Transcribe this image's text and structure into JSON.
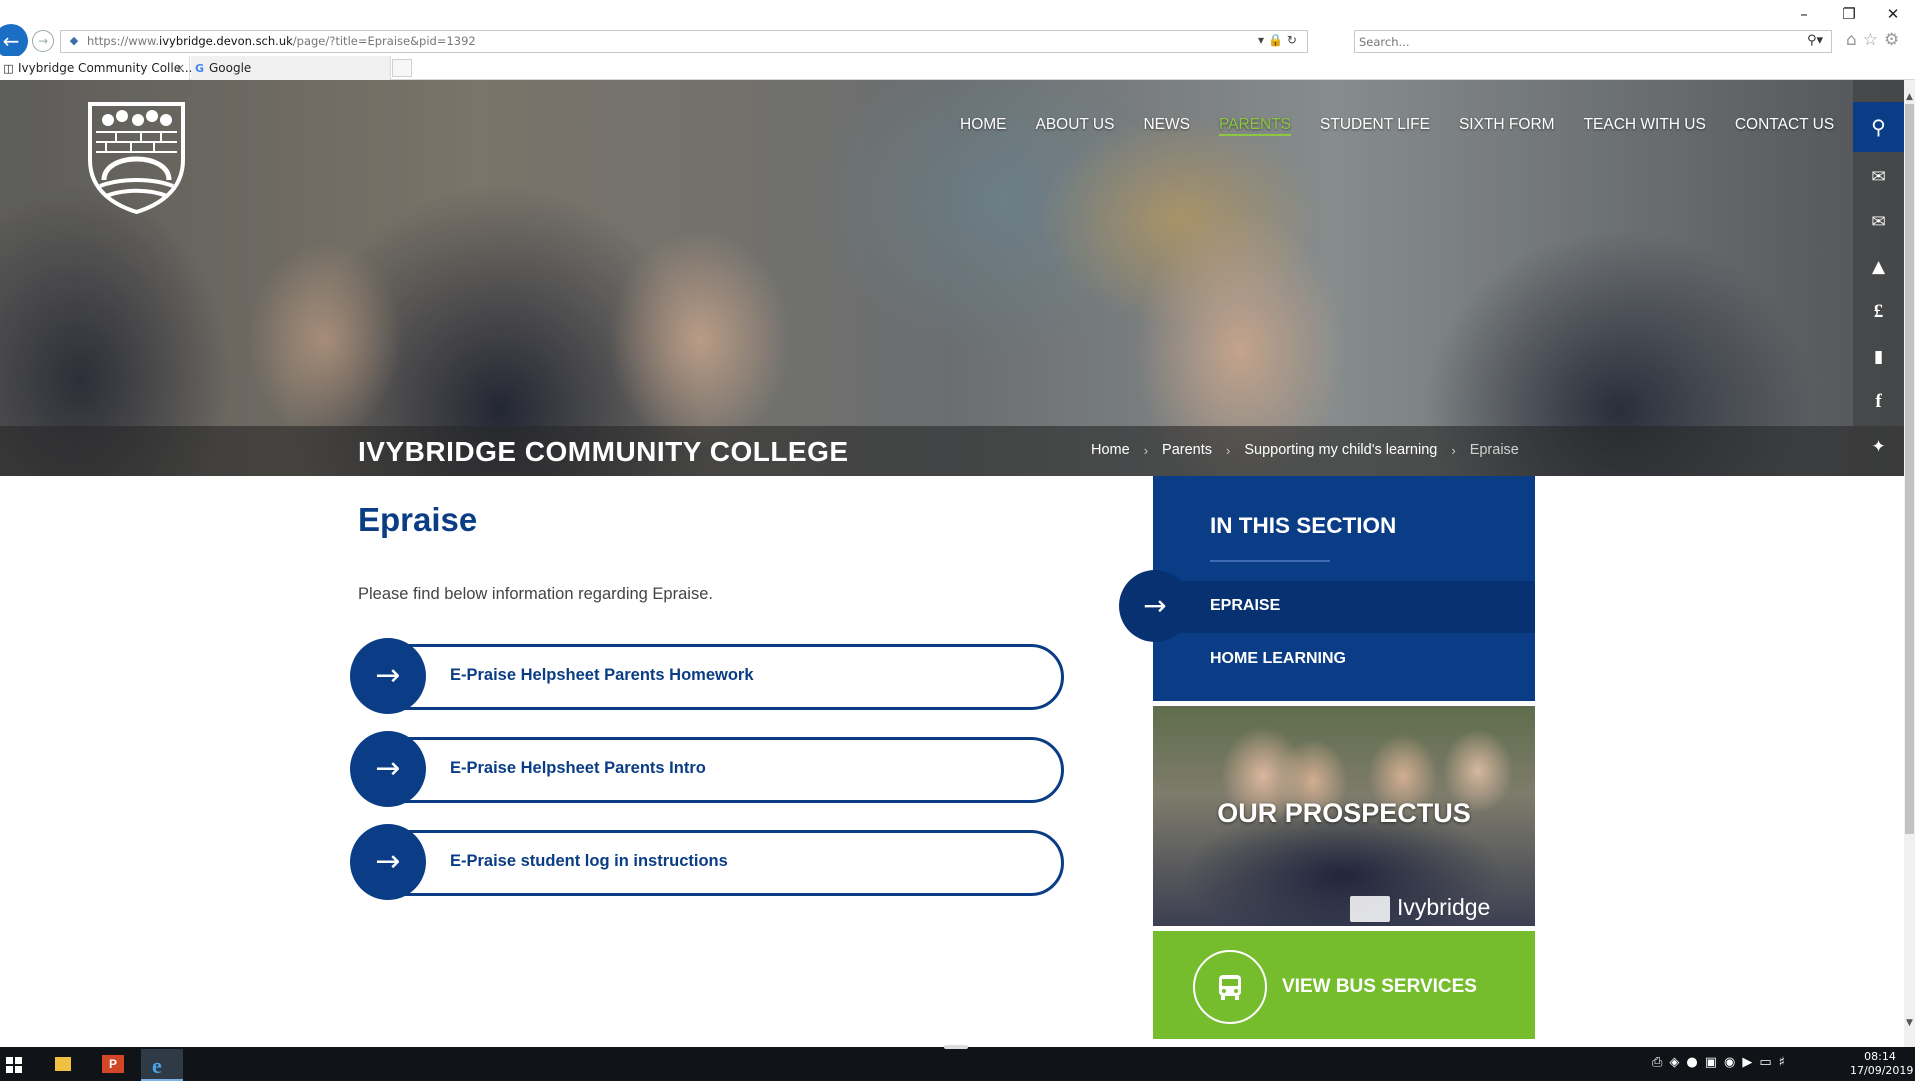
{
  "browser": {
    "url_prefix": "https://www.",
    "url_domain": "ivybridge.devon.sch.uk",
    "url_path": "/page/?title=Epraise&pid=1392",
    "search_placeholder": "Search...",
    "tabs": [
      {
        "label": "Ivybridge Community Colle...",
        "active": true
      },
      {
        "label": "Google",
        "active": false
      }
    ]
  },
  "site": {
    "nav": [
      "HOME",
      "ABOUT US",
      "NEWS",
      "PARENTS",
      "STUDENT LIFE",
      "SIXTH FORM",
      "TEACH WITH US",
      "CONTACT US"
    ],
    "active_nav": "PARENTS",
    "college_name": "IVYBRIDGE COMMUNITY COLLEGE",
    "breadcrumb": [
      "Home",
      "Parents",
      "Supporting my child's learning",
      "Epraise"
    ],
    "rail_icons": [
      "search-icon",
      "envelope-icon",
      "envelope-icon",
      "graduation-cap-icon",
      "pound-icon",
      "document-icon",
      "facebook-icon",
      "twitter-icon"
    ]
  },
  "main": {
    "title": "Epraise",
    "intro": "Please find below information regarding Epraise.",
    "links": [
      "E-Praise Helpsheet Parents Homework",
      "E-Praise Helpsheet Parents Intro",
      "E-Praise student log in instructions"
    ]
  },
  "sidebar": {
    "section_title": "IN THIS SECTION",
    "items": [
      {
        "label": "EPRAISE",
        "active": true
      },
      {
        "label": "HOME LEARNING",
        "active": false
      }
    ],
    "prospectus_title": "OUR PROSPECTUS",
    "prospectus_brand": "Ivybridge",
    "bus_label": "VIEW BUS SERVICES"
  },
  "taskbar": {
    "time": "08:14",
    "date": "17/09/2019"
  },
  "colors": {
    "brand_blue": "#0b3d86",
    "accent_green": "#8dc63f",
    "bus_green": "#76bd2e"
  }
}
